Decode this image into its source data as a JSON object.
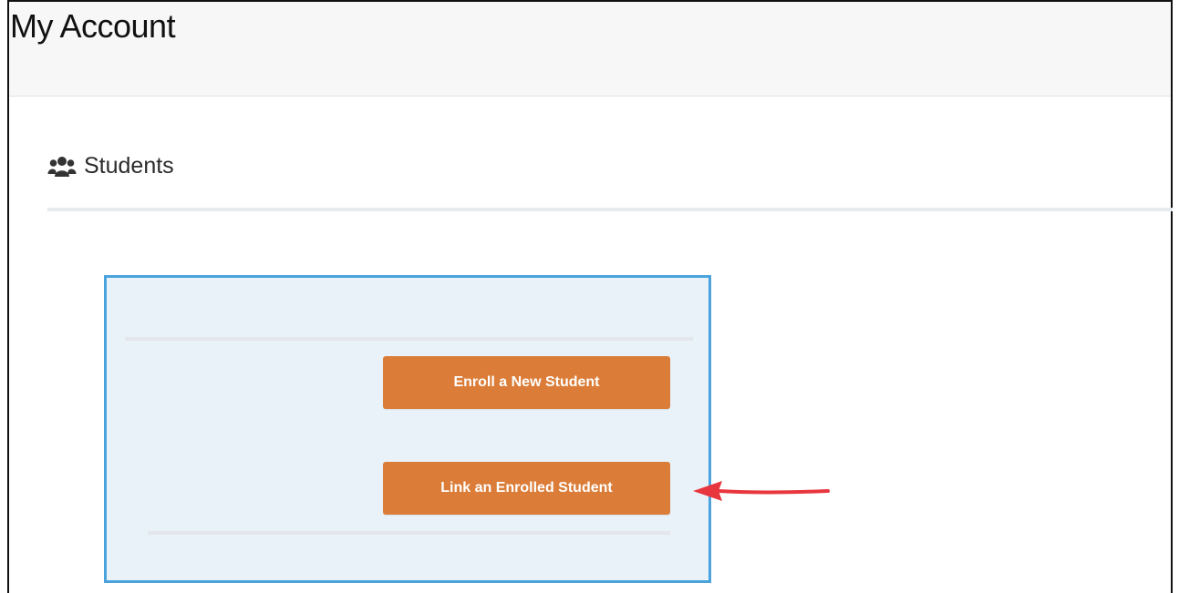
{
  "header": {
    "title": "My Account"
  },
  "section": {
    "icon": "users-icon",
    "title": "Students"
  },
  "actions": {
    "enroll_label": "Enroll a New Student",
    "link_label": "Link an Enrolled Student"
  },
  "colors": {
    "button": "#db7d38",
    "panel_border": "#4aa3dd",
    "panel_background": "#eaf2f9",
    "annotation": "#e8363f"
  },
  "annotation": {
    "icon": "arrow-left-icon"
  }
}
